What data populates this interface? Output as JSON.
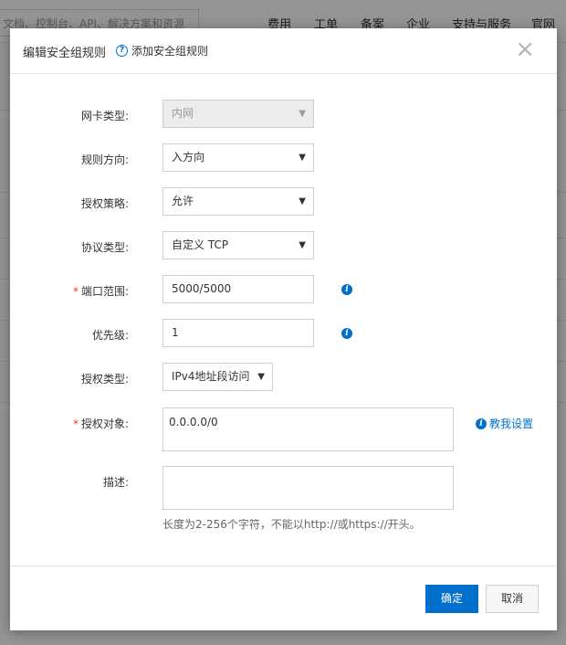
{
  "background": {
    "search_placeholder": "文档、控制台、API、解决方案和资源",
    "nav": [
      "费用",
      "工单",
      "备案",
      "企业",
      "支持与服务",
      "官网"
    ]
  },
  "modal": {
    "title": "编辑安全组规则",
    "help_link": "添加安全组规则",
    "close_symbol": "×",
    "fields": {
      "nic_type": {
        "label": "网卡类型:",
        "value": "内网"
      },
      "direction": {
        "label": "规则方向:",
        "value": "入方向"
      },
      "policy": {
        "label": "授权策略:",
        "value": "允许"
      },
      "protocol": {
        "label": "协议类型:",
        "value": "自定义 TCP"
      },
      "port_range": {
        "label": "端口范围:",
        "value": "5000/5000",
        "required_mark": "*"
      },
      "priority": {
        "label": "优先级:",
        "value": "1"
      },
      "auth_type": {
        "label": "授权类型:",
        "value": "IPv4地址段访问"
      },
      "auth_object": {
        "label": "授权对象:",
        "value": "0.0.0.0/0",
        "required_mark": "*"
      },
      "description": {
        "label": "描述:",
        "value": "",
        "hint": "长度为2-256个字符，不能以http://或https://开头。"
      }
    },
    "teach_link": "教我设置",
    "buttons": {
      "confirm": "确定",
      "cancel": "取消"
    }
  },
  "colors": {
    "primary": "#0070cc",
    "required": "#e0441f"
  },
  "icons": {
    "help": "question-circle-icon",
    "info": "info-circle-icon",
    "close": "close-icon",
    "caret": "caret-down-icon"
  }
}
